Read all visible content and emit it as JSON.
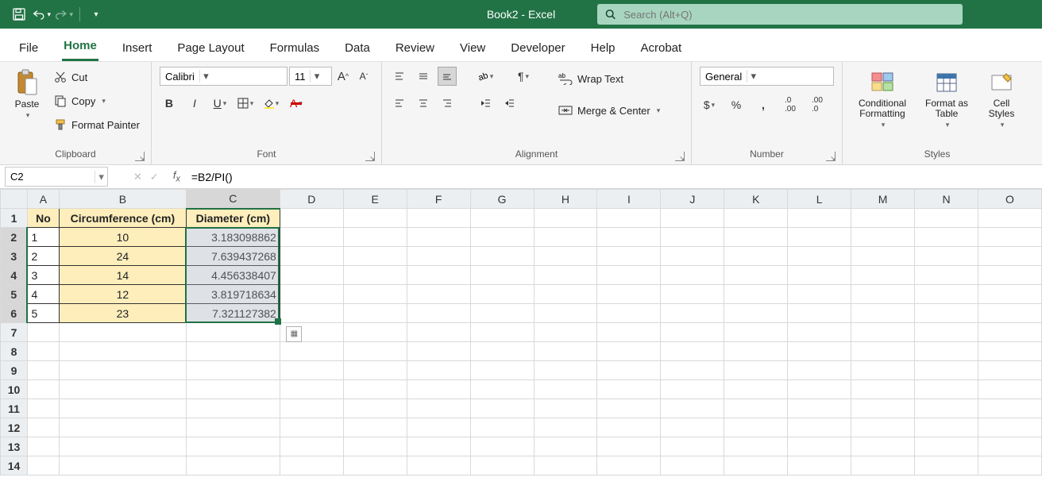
{
  "titlebar": {
    "doc_title": "Book2  -  Excel"
  },
  "search": {
    "placeholder": "Search (Alt+Q)"
  },
  "tabs": {
    "items": [
      "File",
      "Home",
      "Insert",
      "Page Layout",
      "Formulas",
      "Data",
      "Review",
      "View",
      "Developer",
      "Help",
      "Acrobat"
    ],
    "active": 1
  },
  "ribbon": {
    "clipboard": {
      "paste": "Paste",
      "cut": "Cut",
      "copy": "Copy",
      "format_painter": "Format Painter",
      "title": "Clipboard"
    },
    "font": {
      "name": "Calibri",
      "size": "11",
      "title": "Font"
    },
    "alignment": {
      "wrap": "Wrap Text",
      "merge": "Merge & Center",
      "title": "Alignment"
    },
    "number": {
      "format": "General",
      "title": "Number"
    },
    "styles": {
      "cond": "Conditional Formatting",
      "table": "Format as Table",
      "cell": "Cell Styles",
      "title": "Styles"
    }
  },
  "formula_bar": {
    "name_box": "C2",
    "formula": "=B2/PI()"
  },
  "sheet": {
    "columns": [
      "A",
      "B",
      "C",
      "D",
      "E",
      "F",
      "G",
      "H",
      "I",
      "J",
      "K",
      "L",
      "M",
      "N",
      "O"
    ],
    "headers": {
      "A": "No",
      "B": "Circumference (cm)",
      "C": "Diameter (cm)"
    },
    "rows": [
      {
        "no": "1",
        "circ": "10",
        "diam": "3.183098862"
      },
      {
        "no": "2",
        "circ": "24",
        "diam": "7.639437268"
      },
      {
        "no": "3",
        "circ": "14",
        "diam": "4.456338407"
      },
      {
        "no": "4",
        "circ": "12",
        "diam": "3.819718634"
      },
      {
        "no": "5",
        "circ": "23",
        "diam": "7.321127382"
      }
    ],
    "row_count": 14
  }
}
